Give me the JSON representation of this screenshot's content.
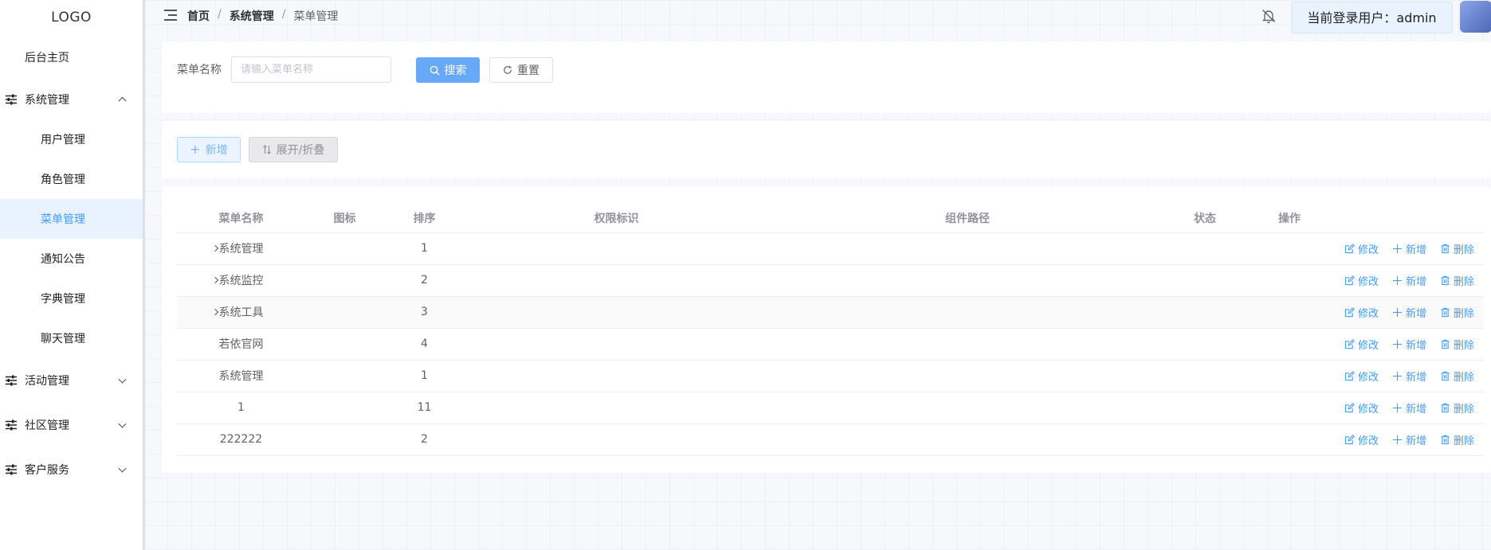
{
  "logo": "LOGO",
  "sidebar": {
    "items": [
      {
        "label": "后台主页"
      },
      {
        "label": "系统管理"
      },
      {
        "label": "用户管理"
      },
      {
        "label": "角色管理"
      },
      {
        "label": "菜单管理"
      },
      {
        "label": "通知公告"
      },
      {
        "label": "字典管理"
      },
      {
        "label": "聊天管理"
      },
      {
        "label": "活动管理"
      },
      {
        "label": "社区管理"
      },
      {
        "label": "客户服务"
      }
    ]
  },
  "header": {
    "breadcrumb": [
      "首页",
      "系统管理",
      "菜单管理"
    ],
    "separator": "/",
    "user_label": "当前登录用户：admin"
  },
  "search": {
    "label": "菜单名称",
    "placeholder": "请输入菜单名称",
    "search_button": "搜索",
    "reset_button": "重置"
  },
  "toolbar": {
    "add_button": "新增",
    "expand_button": "展开/折叠"
  },
  "table": {
    "columns": [
      "菜单名称",
      "图标",
      "排序",
      "权限标识",
      "组件路径",
      "状态",
      "操作"
    ],
    "rows": [
      {
        "name": "系统管理",
        "order": "1",
        "expandable": true
      },
      {
        "name": "系统监控",
        "order": "2",
        "expandable": true
      },
      {
        "name": "系统工具",
        "order": "3",
        "expandable": true
      },
      {
        "name": "若依官网",
        "order": "4",
        "expandable": false
      },
      {
        "name": "系统管理",
        "order": "1",
        "expandable": false
      },
      {
        "name": "1",
        "order": "11",
        "expandable": false
      },
      {
        "name": "222222",
        "order": "2",
        "expandable": false
      }
    ],
    "actions": {
      "edit": "修改",
      "add": "新增",
      "delete": "删除"
    }
  },
  "colors": {
    "primary": "#409eff",
    "active_bg": "#e8f3ff"
  }
}
